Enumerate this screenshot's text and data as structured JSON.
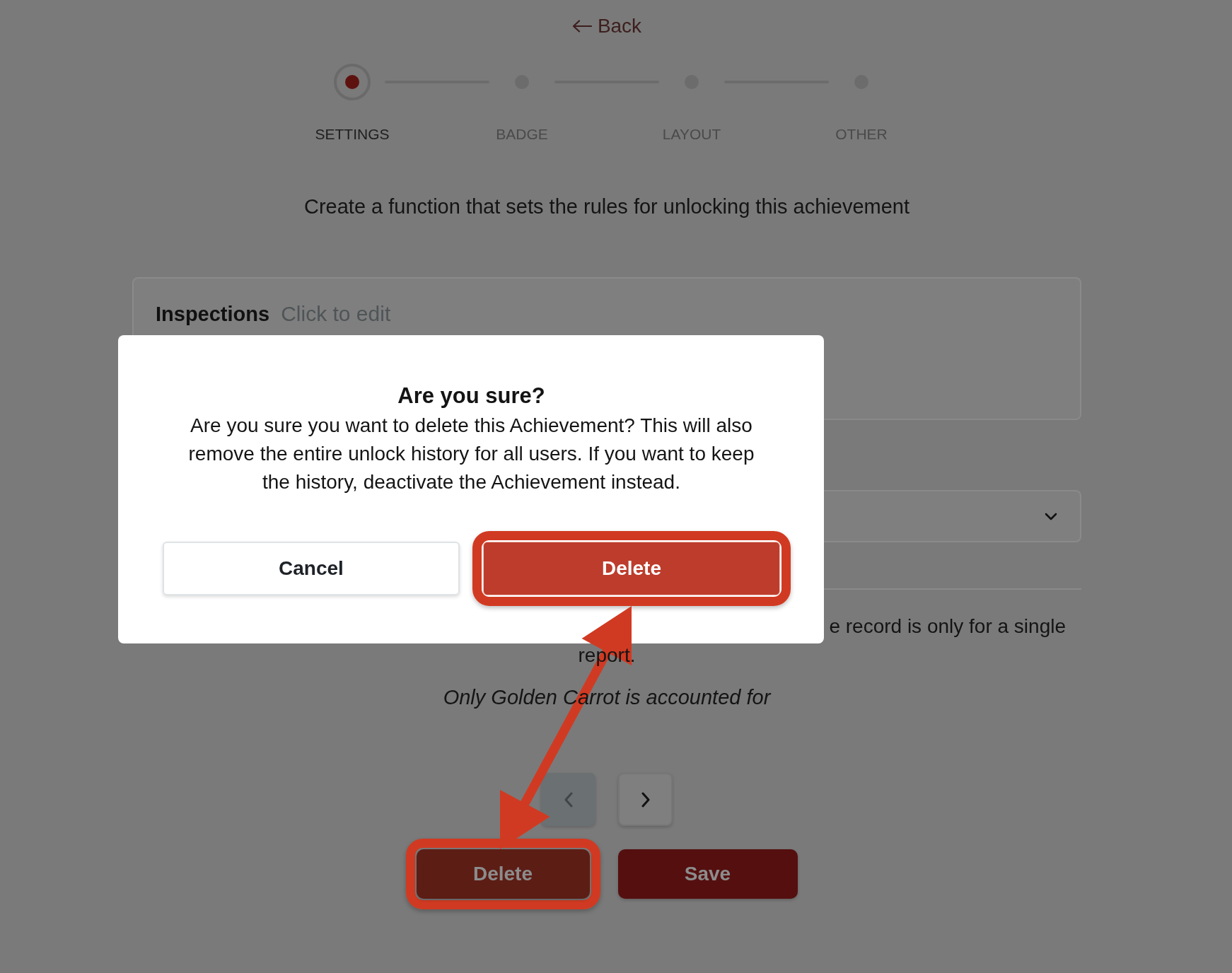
{
  "back_link": {
    "label": "Back"
  },
  "stepper": [
    {
      "label": "SETTINGS",
      "selected": true
    },
    {
      "label": "BADGE",
      "selected": false
    },
    {
      "label": "LAYOUT",
      "selected": false
    },
    {
      "label": "OTHER",
      "selected": false
    }
  ],
  "subtitle": "Create a function that sets the rules for unlocking this achievement",
  "rule_card": {
    "title": "Inspections",
    "edit_hint": "Click to edit"
  },
  "dropdown": {
    "expanded": false
  },
  "note": {
    "line_1_visible_end": "e record is only for a single",
    "line_2": "report."
  },
  "scope_note": "Only Golden Carrot is accounted for",
  "pager": {
    "prev": {
      "disabled": true
    },
    "next": {
      "disabled": false
    }
  },
  "actions": [
    {
      "kind": "delete",
      "label": "Delete",
      "highlighted": true
    },
    {
      "kind": "save",
      "label": "Save",
      "highlighted": false
    }
  ],
  "dialog": {
    "title": "Are you sure?",
    "message": "Are you sure you want to delete this Achievement? This will also remove the entire unlock history for all users. If you want to keep the history, deactivate the Achievement instead.",
    "buttons": [
      {
        "kind": "cancel",
        "label": "Cancel",
        "highlighted": false
      },
      {
        "kind": "confirm",
        "label": "Delete",
        "highlighted": true
      }
    ]
  }
}
